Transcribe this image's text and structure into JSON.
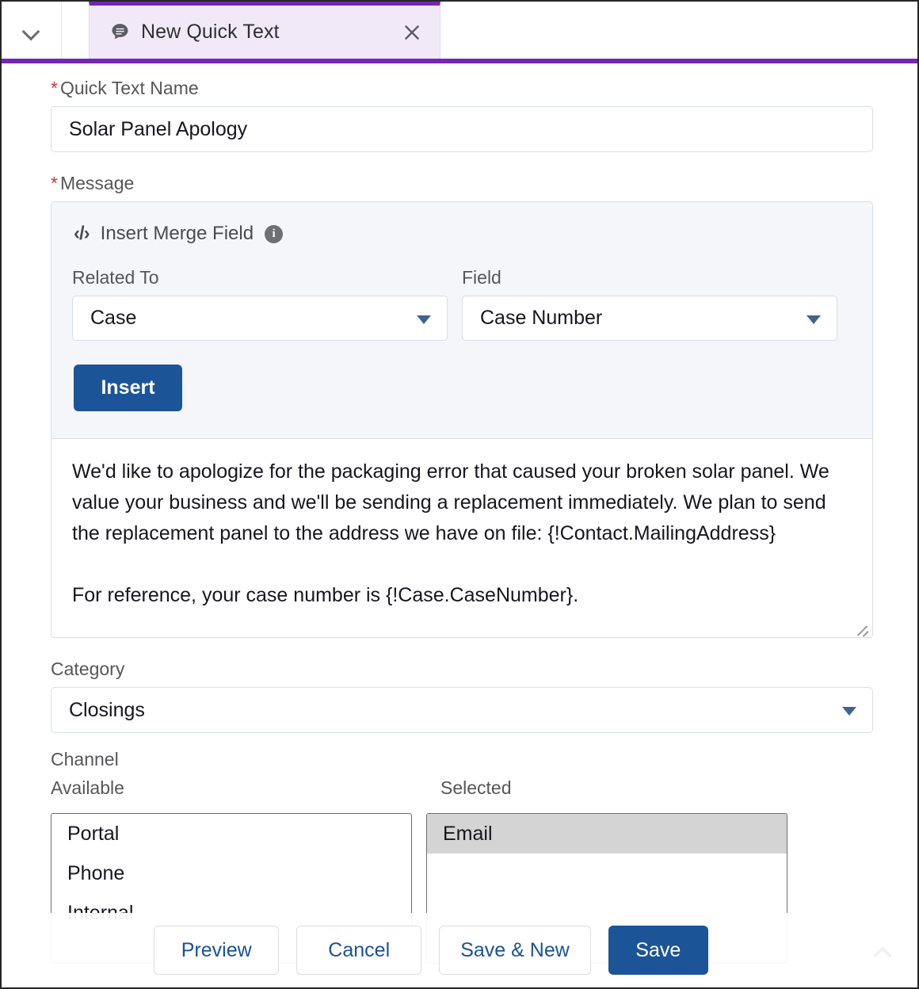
{
  "tab": {
    "title": "New Quick Text",
    "icon": "quick-text-bubble-icon",
    "close_label": "×",
    "accent_color": "#7526b8",
    "background_color": "#f1e9f8"
  },
  "form": {
    "name_field": {
      "label": "Quick Text Name",
      "required_marker": "*",
      "value": "Solar Panel Apology"
    },
    "message_field": {
      "label": "Message",
      "required_marker": "*",
      "value": "We'd like to apologize for the packaging error that caused your broken solar panel. We value your business and we'll be sending a replacement immediately. We plan to send the replacement panel to the address we have on file: {!Contact.MailingAddress}\n\nFor reference, your case number is {!Case.CaseNumber}."
    },
    "merge_field": {
      "heading": "Insert Merge Field",
      "code_icon_glyph": "‹/›",
      "info_icon_glyph": "i",
      "related_to": {
        "label": "Related To",
        "value": "Case"
      },
      "field": {
        "label": "Field",
        "value": "Case Number"
      },
      "insert_button": "Insert"
    },
    "category_field": {
      "label": "Category",
      "value": "Closings"
    },
    "channel_field": {
      "label": "Channel",
      "available_label": "Available",
      "selected_label": "Selected",
      "available_items": [
        "Portal",
        "Phone",
        "Internal"
      ],
      "selected_items": [
        "Email"
      ]
    }
  },
  "footer": {
    "preview_label": "Preview",
    "cancel_label": "Cancel",
    "save_new_label": "Save & New",
    "save_label": "Save",
    "brand_color": "#1c5498"
  }
}
